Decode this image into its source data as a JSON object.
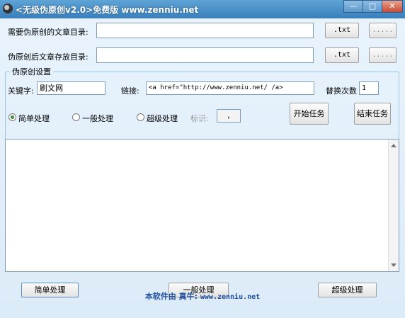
{
  "window": {
    "title": "<无级伪原创v2.0>免费版 www.zenniu.net",
    "minimize": "—",
    "maximize": "□",
    "close": "✕"
  },
  "source": {
    "label": "需要伪原创的文章目录:",
    "value": "",
    "ext": ".txt",
    "browse": "....."
  },
  "target": {
    "label": "伪原创后文章存放目录:",
    "value": "",
    "ext": ".txt",
    "browse": "....."
  },
  "settings": {
    "title": "伪原创设置",
    "keyword_label": "关键字:",
    "keyword_value": "刷文网",
    "link_label": "链接:",
    "link_value": "<a href=\"http://www.zenniu.net/         /a>",
    "replace_label": "替换次数",
    "replace_value": "1",
    "modes": [
      "简单处理",
      "一般处理",
      "超级处理"
    ],
    "selected_mode": "简单处理",
    "mark_label": "标识:",
    "mark_value": ",",
    "start_button": "开始任务",
    "stop_button": "结束任务"
  },
  "log": {
    "content": ""
  },
  "bottom": {
    "simple": "简单处理",
    "normal": "一般处理",
    "super": "超级处理"
  },
  "footer": {
    "text": "本软件由 真牛:",
    "url": "www.zenniu.net"
  },
  "colors": {
    "titlebar": "#3a7fba",
    "background": "#dfeefa",
    "footer_text": "#2050a0"
  }
}
